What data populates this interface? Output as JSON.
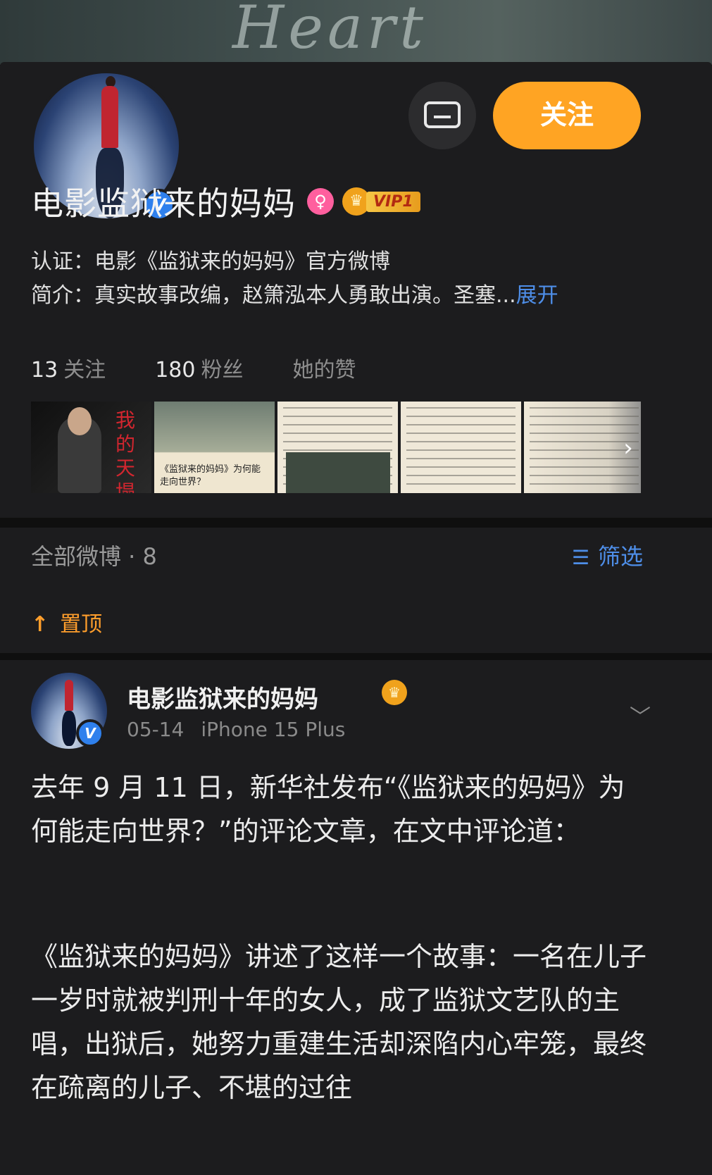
{
  "banner": {
    "text": "Heart"
  },
  "profile": {
    "name": "电影监狱来的妈妈",
    "gender_icon": "female-icon",
    "vip_label": "VIP1",
    "follow_label": "关注",
    "message_icon": "message-icon",
    "verification": "认证：电影《监狱来的妈妈》官方微博",
    "intro": "简介：真实故事改编，赵箫泓本人勇敢出演。圣塞...",
    "expand_label": "展开",
    "stats": {
      "following_count": "13",
      "following_label": "关注",
      "followers_count": "180",
      "followers_label": "粉丝",
      "likes_label": "她的赞"
    },
    "thumb_captions": {
      "t1": "我的天塌",
      "t2": "《监狱来的妈妈》为何能走向世界？"
    }
  },
  "section": {
    "all_posts": "全部微博 · 8",
    "filter_label": "筛选"
  },
  "feed": {
    "pinned_label": "置顶",
    "post": {
      "author": "电影监狱来的妈妈",
      "date": "05-14",
      "source": "iPhone 15 Plus",
      "p1": "去年 9 月 11 日，新华社发布“《监狱来的妈妈》为何能走向世界？”的评论文章，在文中评论道：",
      "p2": "《监狱来的妈妈》讲述了这样一个故事：一名在儿子一岁时就被判刑十年的女人，成了监狱文艺队的主唱，出狱后，她努力重建生活却深陷内心牢笼，最终在疏离的儿子、不堪的过往"
    }
  },
  "colors": {
    "accent_orange": "#ffa423",
    "link_blue": "#4e8ee8",
    "verified_blue": "#2f80ed",
    "pinned_orange": "#ff9e2c",
    "background": "#1c1c1e"
  }
}
